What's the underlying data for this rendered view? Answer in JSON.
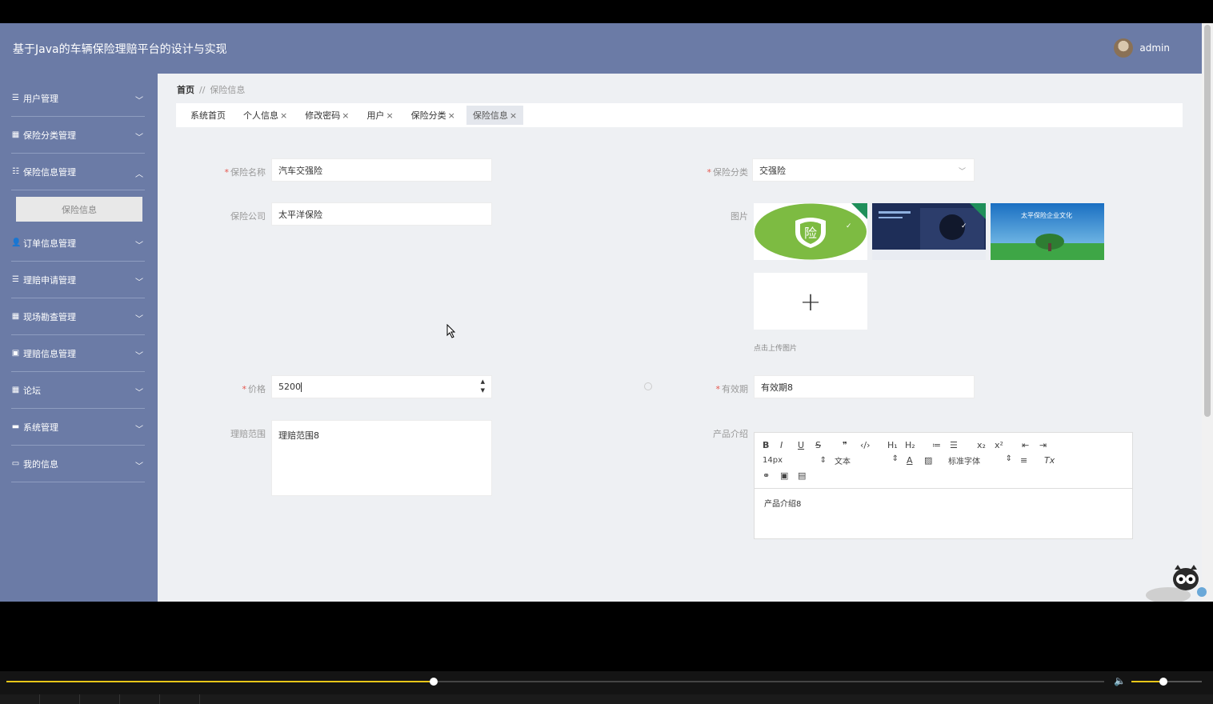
{
  "header": {
    "app_title": "基于Java的车辆保险理赔平台的设计与实现",
    "username": "admin"
  },
  "sidebar": {
    "items": [
      {
        "label": "用户管理",
        "icon": "list-icon",
        "expanded": false
      },
      {
        "label": "保险分类管理",
        "icon": "grid-icon",
        "expanded": false
      },
      {
        "label": "保险信息管理",
        "icon": "sliders-icon",
        "expanded": true
      },
      {
        "label": "订单信息管理",
        "icon": "user-icon",
        "expanded": false
      },
      {
        "label": "理赔申请管理",
        "icon": "list-icon",
        "expanded": false
      },
      {
        "label": "现场勘查管理",
        "icon": "grid-icon",
        "expanded": false
      },
      {
        "label": "理赔信息管理",
        "icon": "calendar-icon",
        "expanded": false
      },
      {
        "label": "论坛",
        "icon": "grid-icon",
        "expanded": false
      },
      {
        "label": "系统管理",
        "icon": "monitor-icon",
        "expanded": false
      },
      {
        "label": "我的信息",
        "icon": "window-icon",
        "expanded": false
      }
    ],
    "sub_item": "保险信息"
  },
  "breadcrumb": {
    "home": "首页",
    "separator": "//",
    "current": "保险信息"
  },
  "tabs": [
    {
      "label": "系统首页",
      "closable": false
    },
    {
      "label": "个人信息",
      "closable": true
    },
    {
      "label": "修改密码",
      "closable": true
    },
    {
      "label": "用户",
      "closable": true
    },
    {
      "label": "保险分类",
      "closable": true
    },
    {
      "label": "保险信息",
      "closable": true,
      "active": true
    }
  ],
  "tab_close_symbol": "×",
  "required_mark": "*",
  "form": {
    "name_label": "保险名称",
    "name_value": "汽车交强险",
    "category_label": "保险分类",
    "category_value": "交强险",
    "company_label": "保险公司",
    "company_value": "太平洋保险",
    "image_label": "图片",
    "images": [
      "保险 logo 图片",
      "保险海报图片",
      "太平保险企业文化"
    ],
    "image3_caption": "太平保险企业文化",
    "image1_glyph": "险",
    "upload_plus": "+",
    "upload_hint": "点击上传图片",
    "price_label": "价格",
    "price_value": "5200",
    "validity_label": "有效期",
    "validity_value": "有效期8",
    "scope_label": "理赔范围",
    "scope_value": "理赔范围8",
    "intro_label": "产品介绍",
    "intro_value": "产品介绍8"
  },
  "editor": {
    "font_size": "14px",
    "paragraph": "文本",
    "font_family": "标准字体"
  },
  "player": {
    "progress": 0.389,
    "volume": 0.45
  },
  "colors": {
    "sidebar_bg": "#6b7ba6",
    "accent_progress": "#e8c619",
    "required": "#e5564c"
  }
}
